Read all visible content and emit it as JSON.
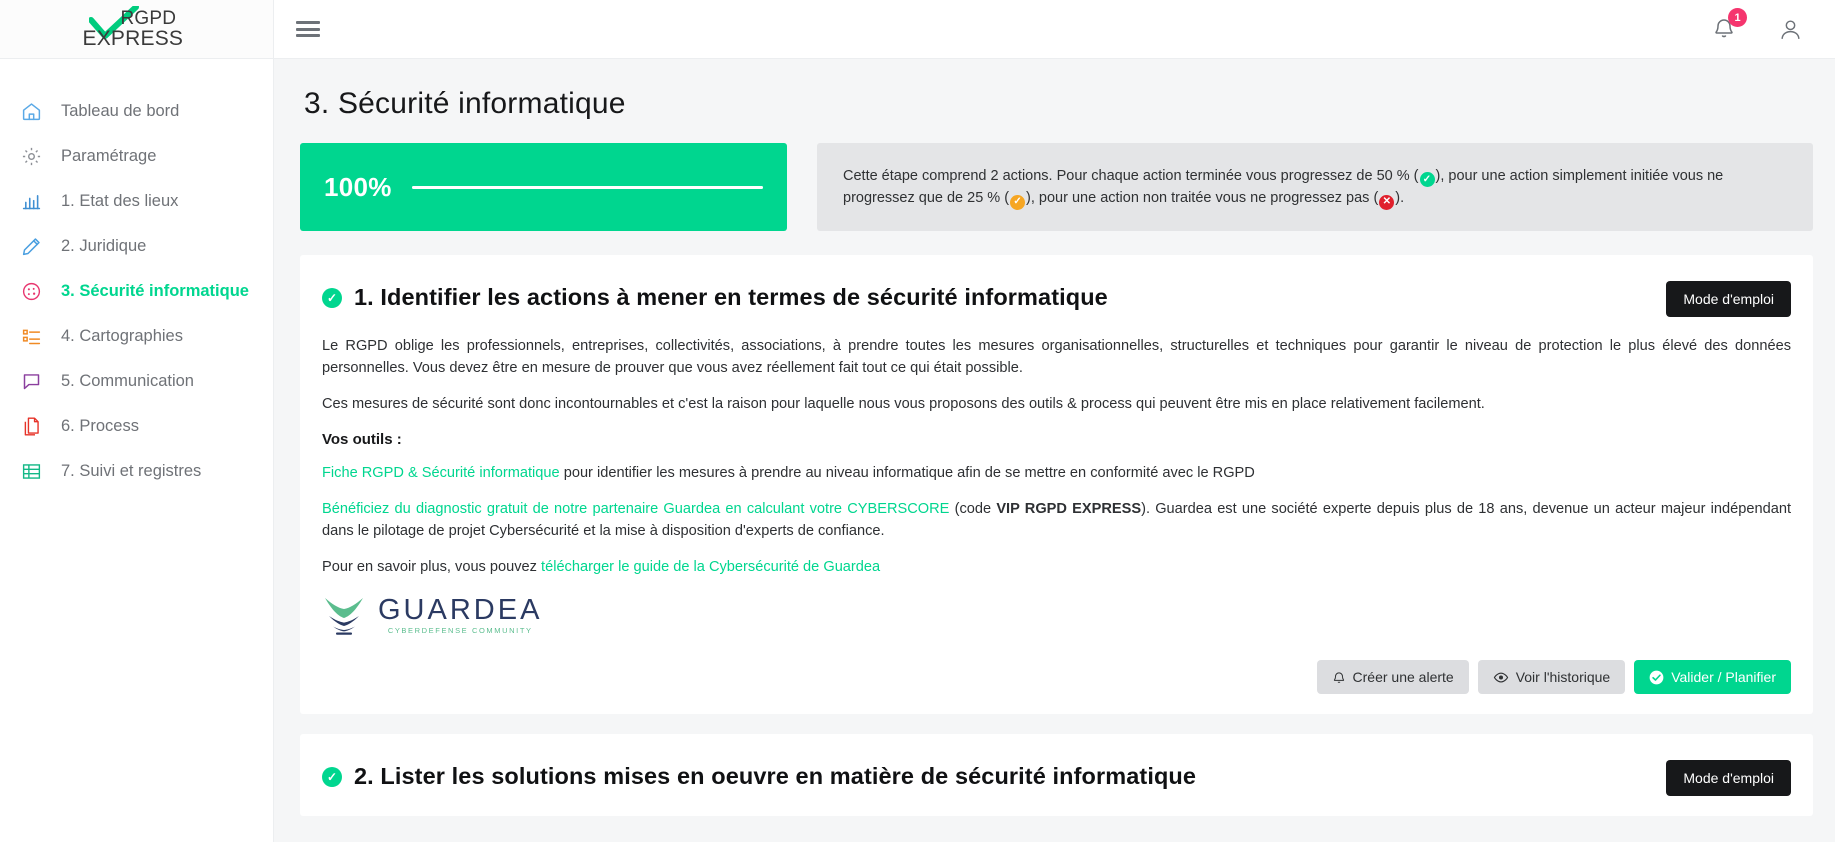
{
  "brand": {
    "line1": "RGPD",
    "line2": "EXPRESS",
    "check_color": "#00cc7e"
  },
  "sidebar": {
    "items": [
      {
        "label": "Tableau de bord",
        "icon": "home-icon",
        "color": "#5aa9e6",
        "active": false
      },
      {
        "label": "Paramétrage",
        "icon": "gear-icon",
        "color": "#8d9096",
        "active": false
      },
      {
        "label": "1. Etat des lieux",
        "icon": "bar-chart-icon",
        "color": "#3f8fd2",
        "active": false
      },
      {
        "label": "2. Juridique",
        "icon": "pencil-icon",
        "color": "#4a9fe0",
        "active": false
      },
      {
        "label": "3. Sécurité informatique",
        "icon": "shield-security-icon",
        "color": "#e8366f",
        "active": true
      },
      {
        "label": "4. Cartographies",
        "icon": "list-icon",
        "color": "#f08a24",
        "active": false
      },
      {
        "label": "5. Communication",
        "icon": "chat-bubble-icon",
        "color": "#8b3f9e",
        "active": false
      },
      {
        "label": "6. Process",
        "icon": "documents-icon",
        "color": "#e63329",
        "active": false
      },
      {
        "label": "7. Suivi et registres",
        "icon": "table-grid-icon",
        "color": "#12b886",
        "active": false
      }
    ]
  },
  "topbar": {
    "menu_icon": "hamburger-menu-icon",
    "notification_icon": "bell-icon",
    "notification_count": "1",
    "notification_badge_color": "#f5356e",
    "account_icon": "user-icon"
  },
  "page": {
    "title": "3. Sécurité informatique"
  },
  "progress": {
    "percent_label": "100%",
    "percent_value": 100,
    "bar_color": "#00d68f"
  },
  "info": {
    "text_part1": "Cette étape comprend 2 actions. Pour chaque action terminée vous progressez de 50 % (",
    "text_part2": "), pour une action simplement initiée vous ne progressez que de 25 % (",
    "text_part3": "), pour une action non traitée vous ne progressez pas (",
    "text_part4": ").",
    "chip_ok": "✓",
    "chip_warn": "✓",
    "chip_bad": "✕"
  },
  "actions": [
    {
      "status_icon": "check-circle-icon",
      "status_mark": "✓",
      "title": "1. Identifier les actions à mener en termes de sécurité informatique",
      "manual_button": "Mode d'emploi",
      "paragraph1": "Le RGPD oblige les professionnels, entreprises, collectivités, associations, à prendre toutes les mesures organisationnelles, structurelles et techniques pour garantir le niveau de protection le plus élevé des données personnelles. Vous devez être en mesure de prouver que vous avez réellement fait tout ce qui était possible.",
      "paragraph2": "Ces mesures de sécurité sont donc incontournables et c'est la raison pour laquelle nous vous proposons des outils & process qui peuvent être mis en place relativement facilement.",
      "tools_label": "Vos outils :",
      "link1_text": "Fiche RGPD & Sécurité informatique",
      "link1_after": " pour identifier les mesures à prendre au niveau informatique afin de se mettre en conformité avec le RGPD",
      "link2_text": "Bénéficiez du diagnostic gratuit de notre partenaire Guardea en calculant votre CYBERSCORE",
      "link2_mid": " (code ",
      "link2_code": "VIP RGPD EXPRESS",
      "link2_after": "). Guardea est une société experte depuis plus de 18 ans, devenue un acteur majeur indépendant dans le pilotage de projet Cybersécurité et la mise à disposition d'experts de confiance.",
      "more_prefix": "Pour en savoir plus, vous pouvez ",
      "more_link": "télécharger le guide de la Cybersécurité de Guardea",
      "partner": {
        "name": "GUARDEA",
        "tagline": "CYBERDEFENSE COMMUNITY",
        "mark_green": "#5bbd8e",
        "mark_navy": "#2b3a62"
      },
      "buttons": [
        {
          "label": "Créer une alerte",
          "icon": "bell-icon",
          "style": "grey"
        },
        {
          "label": "Voir l'historique",
          "icon": "eye-icon",
          "style": "grey"
        },
        {
          "label": "Valider / Planifier",
          "icon": "check-circle-icon",
          "style": "green"
        }
      ]
    },
    {
      "status_icon": "check-circle-icon",
      "status_mark": "✓",
      "title": "2. Lister les solutions mises en oeuvre en matière de sécurité informatique",
      "manual_button": "Mode d'emploi"
    }
  ]
}
